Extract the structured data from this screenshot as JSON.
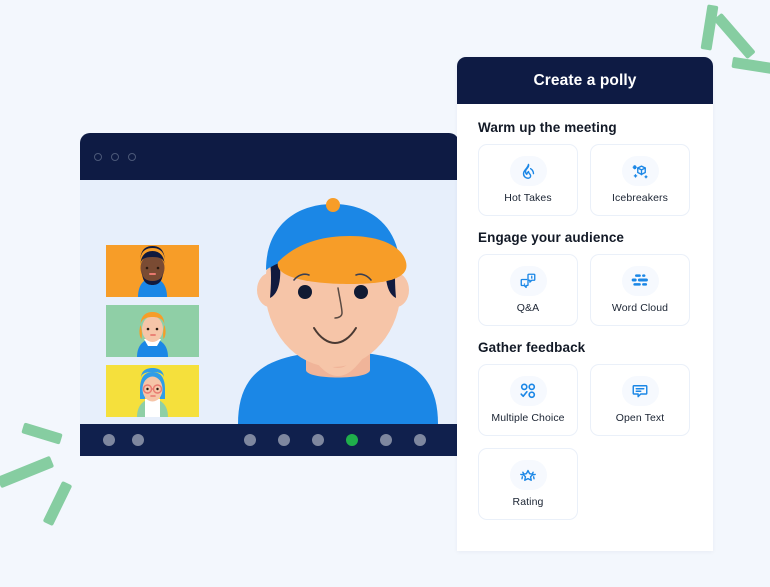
{
  "background_color": "#f3f7fd",
  "accent_color": "#1b87e6",
  "navy_color": "#0e1b44",
  "green_accent": "#86cda1",
  "decorations": {
    "top_right_dashes": 3,
    "bottom_left_dashes": 3,
    "color": "#86cda1"
  },
  "video_window": {
    "name": "video-conference-window",
    "titlebar_dots": 3,
    "titlebar_color": "#0e1b44",
    "stage_background": "#e7effb",
    "participants": [
      {
        "name": "participant-thumbnail-1",
        "background": "#f79d28",
        "hair": "#111a3e",
        "shirt": "#1b87e6"
      },
      {
        "name": "participant-thumbnail-2",
        "background": "#8fcfa6",
        "hair": "#f79d28",
        "shirt": "#1b87e6"
      },
      {
        "name": "participant-thumbnail-3",
        "background": "#f5e03c",
        "hair": "#2f9de8",
        "shirt": "#8fcfa6"
      }
    ],
    "active_speaker": {
      "name": "active-speaker-video",
      "cap_color": "#1b87e6",
      "cap_brim_color": "#f79d28",
      "shirt_color": "#1b87e6",
      "skin_color": "#f6c5a8"
    },
    "control_bar": {
      "left_dots": 2,
      "right_dots": 6,
      "active_dot_index": 3,
      "dot_color": "#7e879f",
      "active_dot_color": "#1faf4b",
      "bar_color": "#10204d"
    }
  },
  "panel": {
    "title": "Create a polly",
    "sections": [
      {
        "title": "Warm up the meeting",
        "cards": [
          {
            "label": "Hot Takes",
            "icon": "flame-icon"
          },
          {
            "label": "Icebreakers",
            "icon": "ice-cube-icon"
          }
        ]
      },
      {
        "title": "Engage your audience",
        "cards": [
          {
            "label": "Q&A",
            "icon": "speech-bubbles-qa-icon"
          },
          {
            "label": "Word Cloud",
            "icon": "word-cloud-bars-icon"
          }
        ]
      },
      {
        "title": "Gather feedback",
        "cards": [
          {
            "label": "Multiple Choice",
            "icon": "multiple-choice-icon"
          },
          {
            "label": "Open Text",
            "icon": "open-text-bubble-icon"
          },
          {
            "label": "Rating",
            "icon": "stars-rating-icon"
          }
        ]
      }
    ]
  }
}
